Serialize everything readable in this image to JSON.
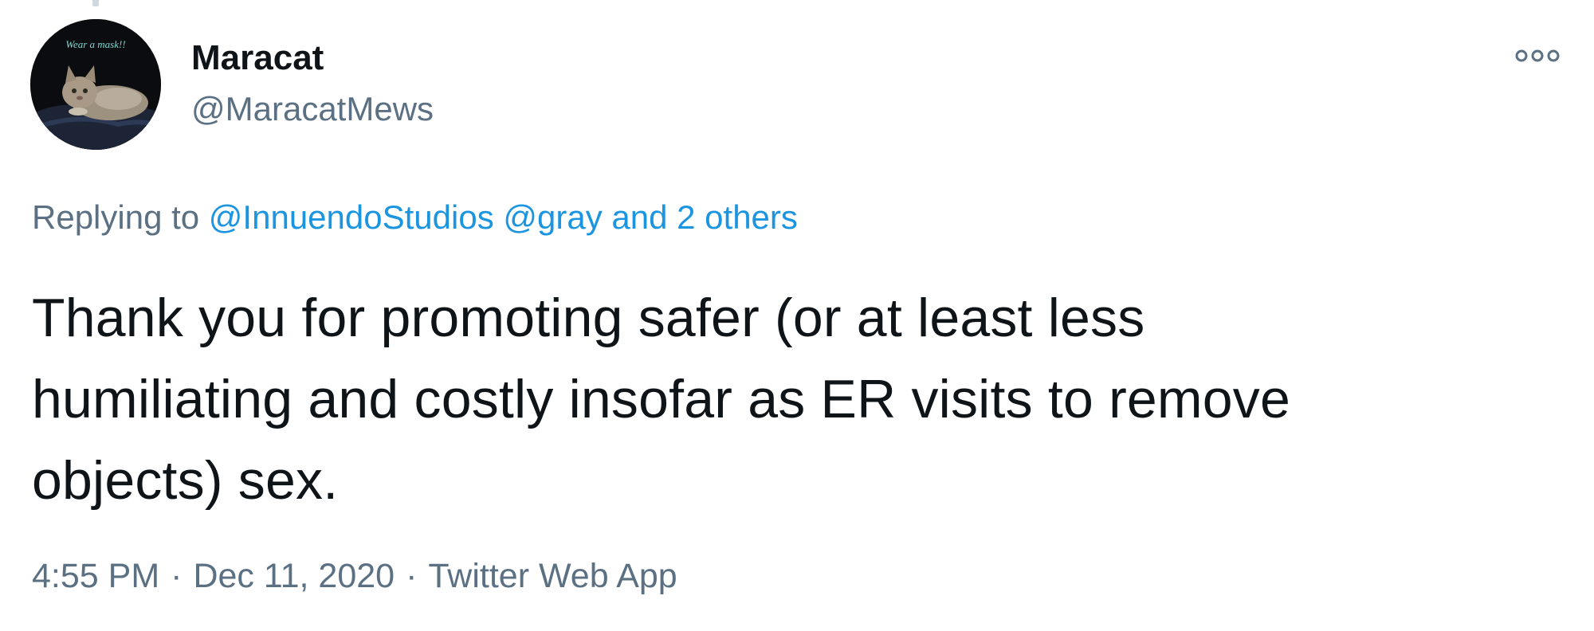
{
  "tweet": {
    "author": {
      "display_name": "Maracat",
      "handle": "@MaracatMews",
      "avatar_caption": "Wear a mask!!"
    },
    "reply_context": {
      "prefix": "Replying to",
      "mention_1": "@InnuendoStudios",
      "mention_2": "@gray",
      "others": "and 2 others"
    },
    "text_lines": [
      "Thank you for promoting safer (or at least less",
      "humiliating and costly insofar as ER visits to remove",
      "objects) sex."
    ],
    "meta": {
      "time": "4:55 PM",
      "separator": "·",
      "date": "Dec 11, 2020",
      "source": "Twitter Web App"
    }
  },
  "icons": {
    "more": "more-options-icon"
  },
  "colors": {
    "text": "#0f1419",
    "secondary": "#5b7083",
    "link": "#1b95e0",
    "background": "#ffffff"
  }
}
